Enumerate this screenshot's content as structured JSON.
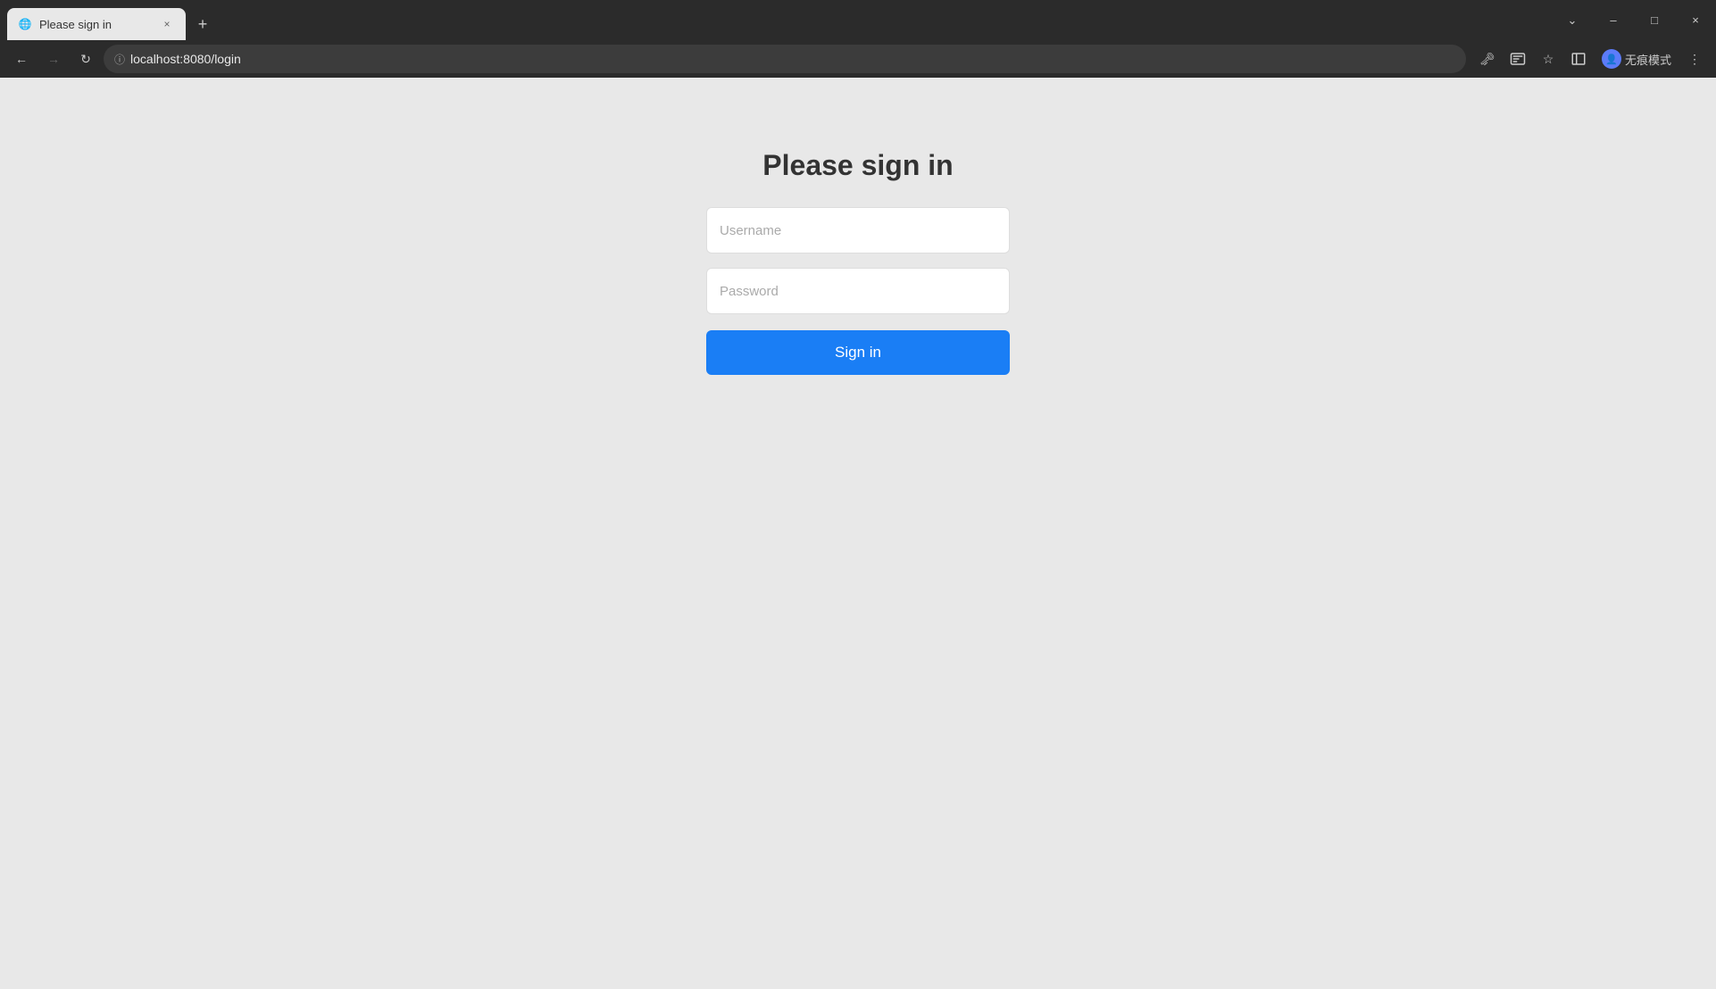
{
  "browser": {
    "tab": {
      "favicon": "🌐",
      "title": "Please sign in",
      "close_label": "×"
    },
    "new_tab_label": "+",
    "window_controls": {
      "chevron_down": "⌄",
      "minimize": "–",
      "maximize": "□",
      "close": "×"
    },
    "nav": {
      "back_label": "←",
      "forward_label": "→",
      "refresh_label": "↻",
      "address": "localhost:8080/login",
      "address_icon": "ⓘ"
    },
    "toolbar": {
      "key_icon": "🗝",
      "translate_icon": "⊞",
      "star_icon": "☆",
      "sidebar_icon": "▭",
      "profile_icon": "👤",
      "profile_label": "无痕模式",
      "menu_icon": "⋮"
    }
  },
  "page": {
    "title": "Please sign in",
    "username_placeholder": "Username",
    "password_placeholder": "Password",
    "sign_in_label": "Sign in"
  }
}
